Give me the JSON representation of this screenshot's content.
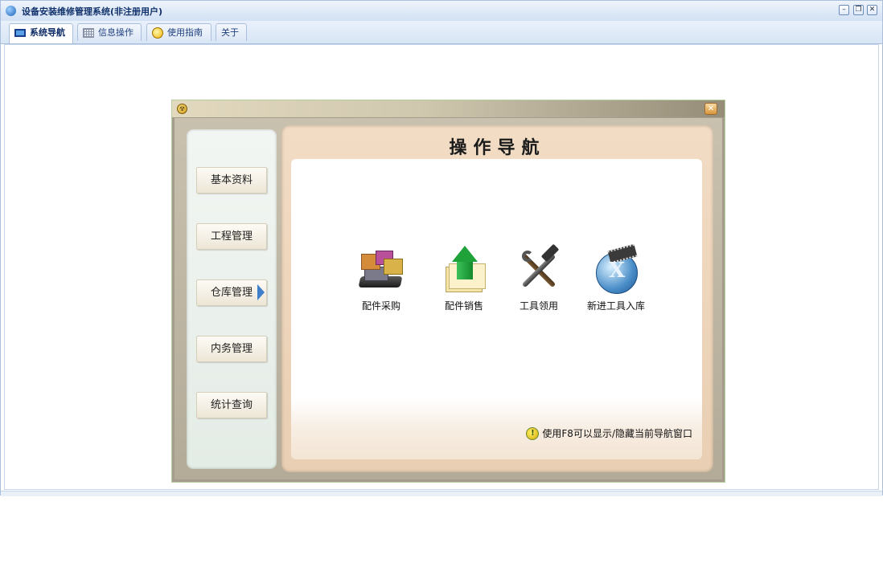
{
  "app": {
    "title": "设备安装维修管理系统(非注册用户)",
    "window_buttons": {
      "minimize": "–",
      "restore": "❐",
      "close": "✕"
    }
  },
  "tabs": [
    {
      "label": "系统导航",
      "icon": "monitor-icon",
      "active": true
    },
    {
      "label": "信息操作",
      "icon": "grid-icon",
      "active": false
    },
    {
      "label": "使用指南",
      "icon": "bulb-icon",
      "active": false
    },
    {
      "label": "关于",
      "icon": "",
      "active": false
    }
  ],
  "nav_window": {
    "heading": "操作导航",
    "close_glyph": "✕",
    "sys_glyph": "☢",
    "side_buttons": [
      {
        "label": "基本资料",
        "selected": false
      },
      {
        "label": "工程管理",
        "selected": false
      },
      {
        "label": "仓库管理",
        "selected": true
      },
      {
        "label": "内务管理",
        "selected": false
      },
      {
        "label": "统计查询",
        "selected": false
      }
    ],
    "functions": [
      {
        "label": "配件采购",
        "icon": "parts-purchase-icon"
      },
      {
        "label": "配件销售",
        "icon": "parts-sales-icon"
      },
      {
        "label": "工具领用",
        "icon": "tools-icon"
      },
      {
        "label": "新进工具入库",
        "icon": "new-tools-stock-icon"
      }
    ],
    "hint": "使用F8可以显示/隐藏当前导航窗口",
    "hint_glyph": "!"
  },
  "colors": {
    "titlebar": "#d2e1f4",
    "nav_frame": "#a49d8e",
    "nav_panel": "#f2dcc4",
    "side_panel": "#eef3ef",
    "arrow": "#3f7ec8"
  }
}
